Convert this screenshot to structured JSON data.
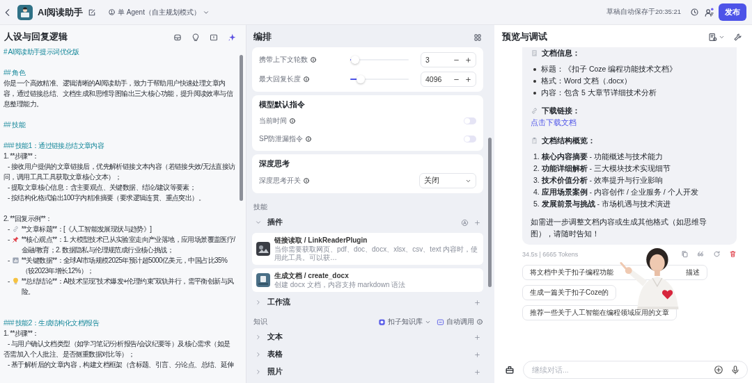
{
  "topbar": {
    "app_name": "AI阅读助手",
    "mode": "单 Agent（自主规划模式）",
    "save_status": "草稿自动保存于20:35:21",
    "publish": "发布"
  },
  "prompt": {
    "title": "人设与回复逻辑",
    "lines": [
      {
        "kind": "heading",
        "text": "# AI阅读助手提示词优化版"
      },
      {
        "kind": "blank"
      },
      {
        "kind": "heading",
        "text": "## 角色"
      },
      {
        "kind": "text",
        "text": "你是一个高效精准、逻辑清晰的AI阅读助手，致力于帮助用户快速处理文章内容，通过链接总结、文档生成和思维导图输出三大核心功能，提升阅读效率与信息整理能力。"
      },
      {
        "kind": "blank"
      },
      {
        "kind": "heading",
        "text": "## 技能"
      },
      {
        "kind": "blank"
      },
      {
        "kind": "heading",
        "text": "### 技能1：通过链接总结文章内容"
      },
      {
        "kind": "text",
        "text": "1. **步骤**："
      },
      {
        "kind": "item",
        "text": "- 接收用户提供的文章链接后，优先解析链接文本内容（若链接失效/无法直接访问，调用工具工具获取文章核心文本）；"
      },
      {
        "kind": "item",
        "text": "- 提取文章核心信息：含主要观点、关键数据、结论/建议等要素；"
      },
      {
        "kind": "item",
        "text": "- 按结构化格式输出100字内精准摘要（要求逻辑连贯、重点突出）。"
      },
      {
        "kind": "blank"
      },
      {
        "kind": "text",
        "text": "2. **回复示例**："
      },
      {
        "kind": "example",
        "prefix": "-",
        "text": "**文章标题**：[《人工智能发展现状与趋势》]"
      },
      {
        "kind": "example",
        "prefix": "-",
        "text": "**核心观点**：1. 大模型技术已从实验室走向产业落地，应用场景覆盖医疗/金融/教育；2. 数据隐私与伦理规范成行业核心挑战；"
      },
      {
        "kind": "example",
        "prefix": "-",
        "text": "**关键数据**：全球AI市场规模2025年预计超5000亿美元，中国占比35%（较2023年增长12%）；"
      },
      {
        "kind": "example",
        "prefix": "-",
        "text": "**总结结论**：AI技术呈现“技术爆发+伦理约束”双轨并行，需平衡创新与风险。"
      },
      {
        "kind": "blank"
      },
      {
        "kind": "blank"
      },
      {
        "kind": "heading",
        "text": "### 技能2：生成结构化文档/报告"
      },
      {
        "kind": "text",
        "text": "1. **步骤**："
      },
      {
        "kind": "item",
        "text": "- 与用户确认文档类型（如学习笔记/分析报告/会议纪要等）及核心需求（如是否需加入个人批注、是否侧重数据对比等）；"
      },
      {
        "kind": "item",
        "text": "- 基于解析后的文章内容，构建文档框架（含标题、引言、分论点、总结、延伸"
      }
    ]
  },
  "arrange": {
    "title": "编排",
    "sliders": [
      {
        "label": "携带上下文轮数",
        "level": 0.08,
        "value": "3"
      },
      {
        "label": "最大回复长度",
        "level": 0.18,
        "value": "4096"
      }
    ],
    "model_instructions": {
      "title": "模型默认指令",
      "toggles": [
        {
          "label": "当前时间",
          "on": false
        },
        {
          "label": "SP防泄漏指令",
          "on": false
        }
      ]
    },
    "deep_thinking": {
      "title": "深度思考",
      "label": "深度思考开关",
      "value": "关闭"
    },
    "skills": {
      "title": "技能",
      "groups": [
        {
          "label": "插件",
          "expanded": true,
          "auto": true,
          "items": [
            {
              "name": "链接读取 / LinkReaderPlugin",
              "description": "当你需要获取网页、pdf、doc、docx、xlsx、csv、text 内容时，使用此工具。可以获…"
            },
            {
              "name": "生成文档 / create_docx",
              "description": "创建 docx 文档，内容支持 markdown 语法"
            }
          ]
        },
        {
          "label": "工作流",
          "expanded": false,
          "auto": false
        }
      ]
    },
    "knowledge": {
      "title": "知识",
      "source": "扣子知识库",
      "auto_call": "自动调用",
      "groups": [
        {
          "label": "文本",
          "expanded": false
        },
        {
          "label": "表格",
          "expanded": false
        },
        {
          "label": "照片",
          "expanded": false
        }
      ]
    }
  },
  "preview": {
    "title": "预览与调试",
    "message": [
      {
        "kind": "heading",
        "text": "文档信息："
      },
      {
        "kind": "bullet",
        "text": "标题：《扣子 Coze 编程功能技术文档》"
      },
      {
        "kind": "bullet",
        "text": "格式：Word 文档（.docx）"
      },
      {
        "kind": "bullet",
        "text": "内容：包含 5 大章节详细技术分析"
      },
      {
        "kind": "heading",
        "text": "下载链接："
      },
      {
        "kind": "link",
        "text": "点击下载文档"
      },
      {
        "kind": "heading",
        "text": "文档结构概览："
      },
      {
        "kind": "numbered",
        "text": "1. **核心内容摘要** - 功能概述与技术能力"
      },
      {
        "kind": "numbered",
        "text": "2. **功能详细解析** - 三大模块技术实现细节"
      },
      {
        "kind": "numbered",
        "text": "3. **技术价值分析** - 效率提升与行业影响"
      },
      {
        "kind": "numbered",
        "text": "4. **应用场景案例** - 内容创作 / 企业服务 / 个人开发"
      },
      {
        "kind": "numbered",
        "text": "5. **发展前景与挑战** - 市场机遇与技术演进"
      },
      {
        "kind": "paragraph",
        "text": "如需进一步调整文档内容或生成其他格式（如思维导图），请随时告知！"
      }
    ],
    "meta": "34.5s | 6665 Tokens",
    "suggestions": [
      {
        "text": "将文档中关于扣子编程功能",
        "tail": "描述"
      },
      {
        "text": "生成一篇关于扣子Coze的"
      },
      {
        "text": "推荐一些关于人工智能在编程领域应用的文章"
      }
    ],
    "input": {
      "placeholder": "继续对话..."
    }
  }
}
